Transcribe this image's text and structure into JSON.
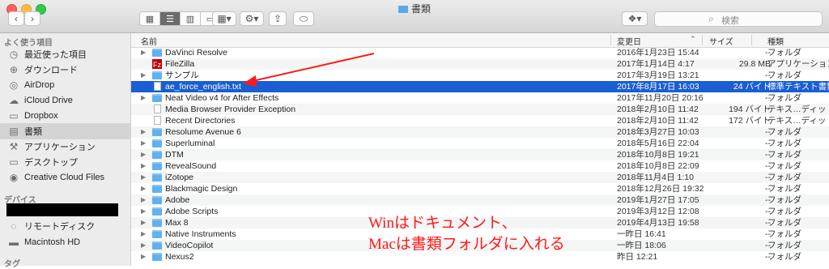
{
  "window": {
    "title": "書類"
  },
  "toolbar": {
    "back_icon": "chevron-left",
    "forward_icon": "chevron-right",
    "view_modes": [
      "icon-view",
      "list-view",
      "column-view",
      "gallery-view"
    ],
    "share_icon": "share",
    "tag_icon": "tag",
    "search_placeholder": "検索"
  },
  "sidebar": {
    "favorites_header": "よく使う項目",
    "favorites": [
      {
        "label": "最近使った項目",
        "icon": "clock"
      },
      {
        "label": "ダウンロード",
        "icon": "download"
      },
      {
        "label": "AirDrop",
        "icon": "airdrop"
      },
      {
        "label": "iCloud Drive",
        "icon": "cloud"
      },
      {
        "label": "Dropbox",
        "icon": "folder"
      },
      {
        "label": "書類",
        "icon": "document"
      },
      {
        "label": "アプリケーション",
        "icon": "apps"
      },
      {
        "label": "デスクトップ",
        "icon": "desktop"
      },
      {
        "label": "Creative Cloud Files",
        "icon": "creative-cloud"
      }
    ],
    "devices_header": "デバイス",
    "devices": [
      {
        "label": "リモートディスク",
        "icon": "disc"
      },
      {
        "label": "Macintosh HD",
        "icon": "hard-disk"
      }
    ],
    "tags_header": "タグ"
  },
  "columns": {
    "name": "名前",
    "date": "変更日",
    "size": "サイズ",
    "kind": "種類"
  },
  "files": [
    {
      "name": "DaVinci Resolve",
      "date": "2016年1月23日 15:44",
      "size": "--",
      "kind": "フォルダ",
      "type": "folder"
    },
    {
      "name": "FileZilla",
      "date": "2017年1月14日 4:17",
      "size": "29.8 MB",
      "kind": "アプリケーション",
      "type": "app"
    },
    {
      "name": "サンプル",
      "date": "2017年3月19日 13:21",
      "size": "--",
      "kind": "フォルダ",
      "type": "folder"
    },
    {
      "name": "ae_force_english.txt",
      "date": "2017年8月17日 16:03",
      "size": "24 バイト",
      "kind": "標準テキスト書類",
      "type": "doc",
      "selected": true
    },
    {
      "name": "Neat Video v4 for After Effects",
      "date": "2017年11月20日 20:16",
      "size": "--",
      "kind": "フォルダ",
      "type": "folder"
    },
    {
      "name": "Media Browser Provider Exception",
      "date": "2018年2月10日 11:42",
      "size": "194 バイト",
      "kind": "テキス…ディット",
      "type": "doc"
    },
    {
      "name": "Recent Directories",
      "date": "2018年2月10日 11:42",
      "size": "172 バイト",
      "kind": "テキス…ディット",
      "type": "doc"
    },
    {
      "name": "Resolume Avenue 6",
      "date": "2018年3月27日 10:03",
      "size": "--",
      "kind": "フォルダ",
      "type": "folder"
    },
    {
      "name": "Superluminal",
      "date": "2018年5月16日 22:04",
      "size": "--",
      "kind": "フォルダ",
      "type": "folder"
    },
    {
      "name": "DTM",
      "date": "2018年10月8日 19:21",
      "size": "--",
      "kind": "フォルダ",
      "type": "folder"
    },
    {
      "name": "RevealSound",
      "date": "2018年10月8日 22:09",
      "size": "--",
      "kind": "フォルダ",
      "type": "folder"
    },
    {
      "name": "iZotope",
      "date": "2018年11月4日 1:10",
      "size": "--",
      "kind": "フォルダ",
      "type": "folder"
    },
    {
      "name": "Blackmagic Design",
      "date": "2018年12月26日 19:32",
      "size": "--",
      "kind": "フォルダ",
      "type": "folder"
    },
    {
      "name": "Adobe",
      "date": "2019年1月27日 17:05",
      "size": "--",
      "kind": "フォルダ",
      "type": "folder"
    },
    {
      "name": "Adobe Scripts",
      "date": "2019年3月12日 12:08",
      "size": "--",
      "kind": "フォルダ",
      "type": "folder"
    },
    {
      "name": "Max 8",
      "date": "2019年4月13日 19:58",
      "size": "--",
      "kind": "フォルダ",
      "type": "folder"
    },
    {
      "name": "Native Instruments",
      "date": "一昨日 16:41",
      "size": "--",
      "kind": "フォルダ",
      "type": "folder"
    },
    {
      "name": "VideoCopilot",
      "date": "一昨日 18:06",
      "size": "--",
      "kind": "フォルダ",
      "type": "folder"
    },
    {
      "name": "Nexus2",
      "date": "昨日 12:21",
      "size": "--",
      "kind": "フォルダ",
      "type": "folder"
    }
  ],
  "annotation": {
    "line1": "Winはドキュメント、",
    "line2": "Macは書類フォルダに入れる",
    "color": "#ff1a1a"
  },
  "colors": {
    "selection": "#1a5ed3",
    "folder": "#62b0ee"
  }
}
